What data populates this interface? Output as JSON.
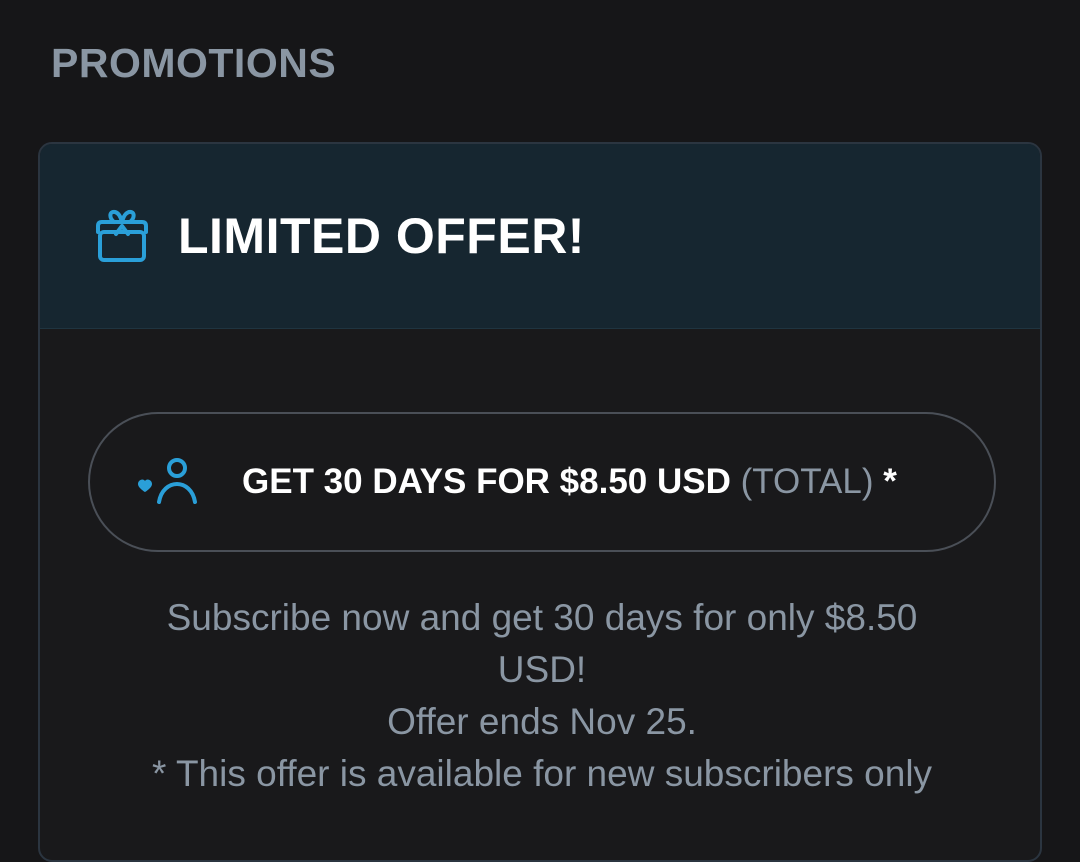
{
  "section": {
    "title": "PROMOTIONS"
  },
  "promo": {
    "title": "LIMITED OFFER!",
    "icon": "gift-icon",
    "accent_color": "#2a9fd8",
    "offer_button": {
      "icon": "subscriber-icon",
      "main_label": "GET 30 DAYS FOR $8.50 USD",
      "total_label": "(TOTAL)",
      "asterisk": "*"
    },
    "description": {
      "line1": "Subscribe now and get 30 days for only $8.50",
      "line2": "USD!",
      "line3": "Offer ends Nov 25.",
      "line4": "* This offer is available for new subscribers only"
    }
  },
  "colors": {
    "background": "#161618",
    "header_background": "#162630",
    "muted_text": "#8a96a3",
    "primary_text": "#ffffff"
  }
}
